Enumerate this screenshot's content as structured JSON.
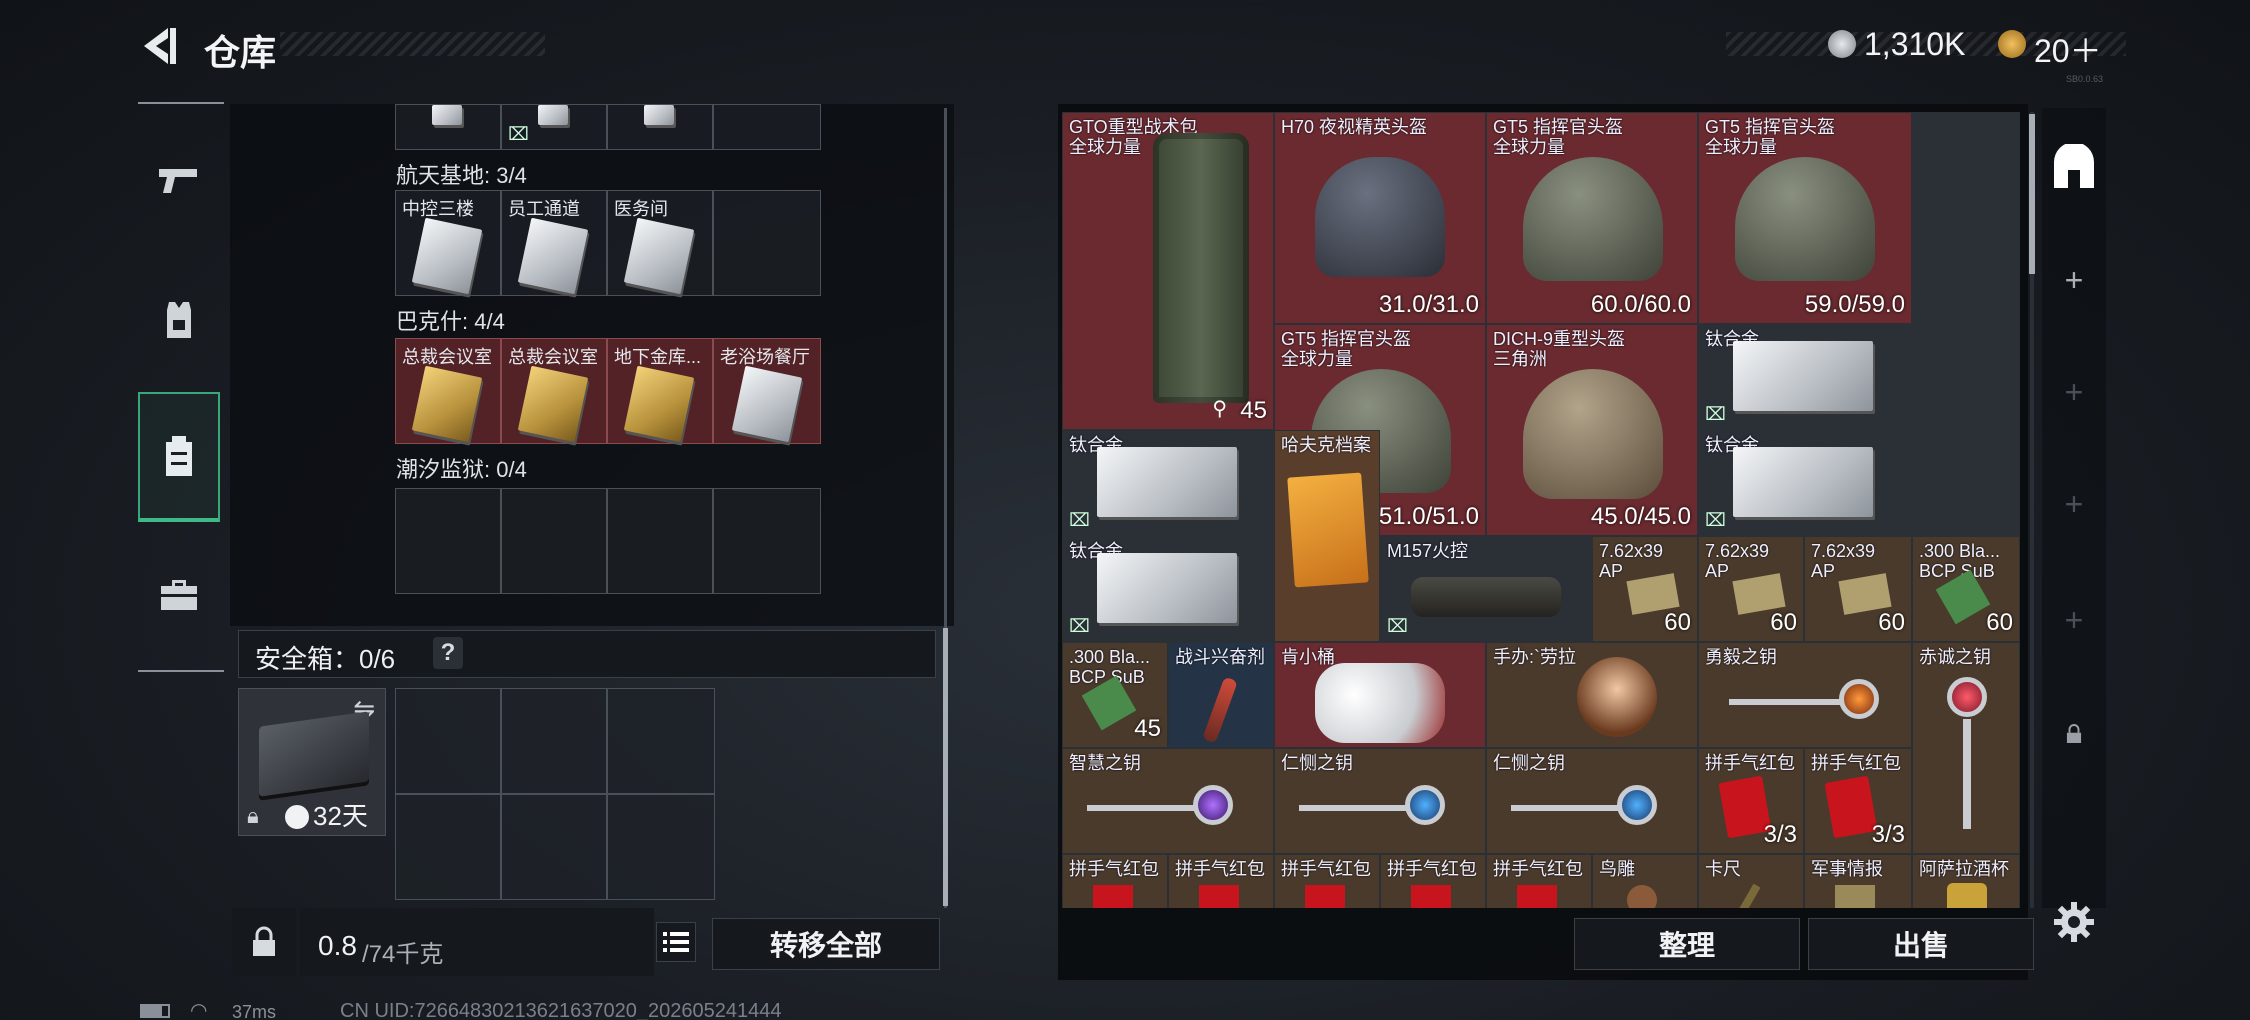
{
  "header": {
    "title": "仓库",
    "currency1": "1,310K",
    "currency2": "20＋"
  },
  "left": {
    "sections": [
      {
        "label": "航天基地: 3/4",
        "cards": [
          "中控三楼",
          "员工通道",
          "医务间"
        ]
      },
      {
        "label": "巴克什: 4/4",
        "cards": [
          "总裁会议室",
          "总裁会议室",
          "地下金库...",
          "老浴场餐厅"
        ]
      },
      {
        "label": "潮汐监狱: 0/4"
      }
    ],
    "safe_box": {
      "label": "安全箱：0/6",
      "help": "?",
      "timer": "32天"
    },
    "weight": {
      "current": "0.8",
      "capacity": "/74千克"
    },
    "transfer_label": "转移全部"
  },
  "right": {
    "items": {
      "gto": {
        "name": "GTO重型战术包",
        "sub": "全球力量",
        "qty": "45"
      },
      "h70": {
        "name": "H70 夜视精英头盔",
        "dur": "31.0/31.0"
      },
      "gt5a": {
        "name": "GT5 指挥官头盔",
        "sub": "全球力量",
        "dur": "60.0/60.0"
      },
      "gt5b": {
        "name": "GT5 指挥官头盔",
        "sub": "全球力量",
        "dur": "59.0/59.0"
      },
      "gt5c": {
        "name": "GT5 指挥官头盔",
        "sub": "全球力量",
        "dur": "51.0/51.0"
      },
      "dich": {
        "name": "DICH-9重型头盔",
        "sub": "三角洲",
        "dur": "45.0/45.0"
      },
      "ti1": "钛合金",
      "ti2": "钛合金",
      "ti3": "钛合金",
      "ti4": "钛合金",
      "haff": "哈夫克档案",
      "m157": "M157火控",
      "ammo1": {
        "name": "7.62x39",
        "sub": "AP",
        "qty": "60"
      },
      "ammo2": {
        "name": "7.62x39",
        "sub": "AP",
        "qty": "60"
      },
      "ammo3": {
        "name": "7.62x39",
        "sub": "AP",
        "qty": "60"
      },
      "ammo4": {
        "name": ".300 Bla...",
        "sub": "BCP SuB",
        "qty": "60"
      },
      "ammo5": {
        "name": ".300 Bla...",
        "sub": "BCP SuB",
        "qty": "45"
      },
      "stim": "战斗兴奋剂",
      "bucket": "肯小桶",
      "figure": "手办:`劳拉",
      "yong": "勇毅之钥",
      "chi": "赤诚之钥",
      "zhi": "智慧之钥",
      "ren1": "仁恻之钥",
      "ren2": "仁恻之钥",
      "hb1": {
        "name": "拼手气红包",
        "qty": "3/3"
      },
      "hb2": {
        "name": "拼手气红包",
        "qty": "3/3"
      },
      "bottom_row": [
        "拼手气红包",
        "拼手气红包",
        "拼手气红包",
        "拼手气红包",
        "拼手气红包",
        "鸟雕",
        "卡尺",
        "军事情报",
        "阿萨拉酒杯"
      ]
    },
    "sort_label": "整理",
    "sell_label": "出售"
  },
  "status": {
    "ping": "37ms",
    "uid": "CN UID:72664830213621637020_202605241444",
    "version": "SB0.0.63"
  },
  "colors": {
    "accent": "#3fb986",
    "red_cell": "#6a2a2f"
  }
}
